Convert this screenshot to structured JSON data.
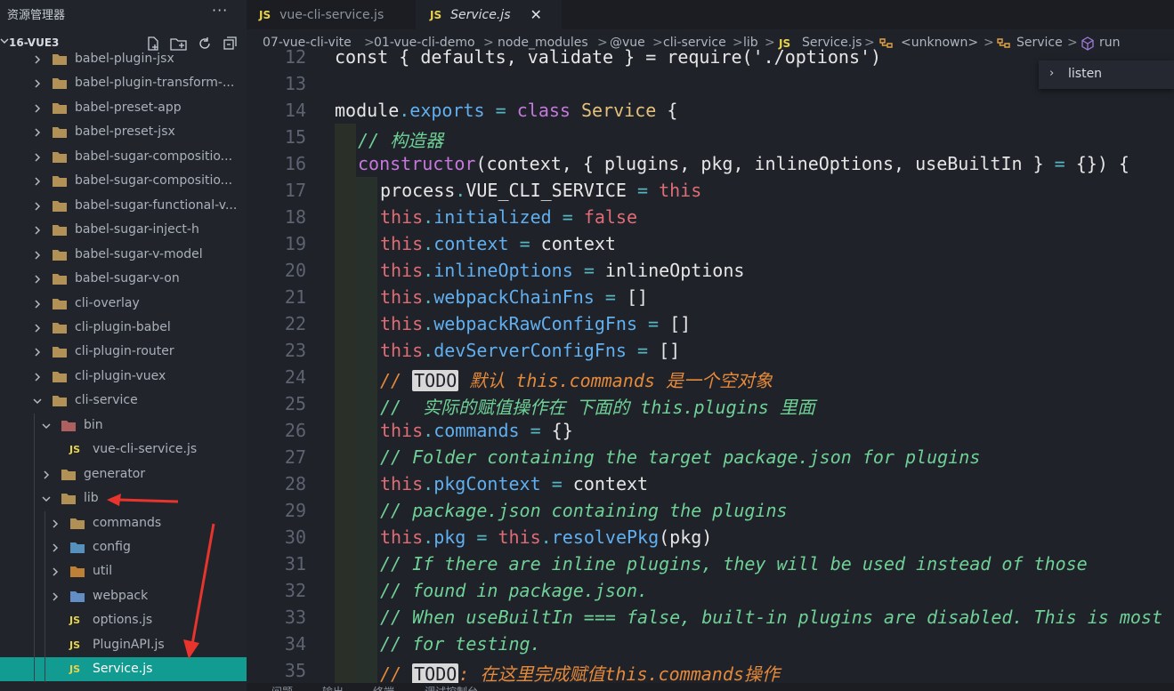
{
  "sidebar": {
    "title": "资源管理器",
    "more": "···",
    "project": "16-VUE3",
    "actions": [
      "new-file-icon",
      "new-folder-icon",
      "refresh-icon",
      "collapse-all-icon"
    ],
    "tree": [
      {
        "label": "babel-plugin-jsx",
        "type": "folder",
        "depth": 0,
        "expanded": false
      },
      {
        "label": "babel-plugin-transform-...",
        "type": "folder",
        "depth": 0,
        "expanded": false
      },
      {
        "label": "babel-preset-app",
        "type": "folder",
        "depth": 0,
        "expanded": false
      },
      {
        "label": "babel-preset-jsx",
        "type": "folder",
        "depth": 0,
        "expanded": false
      },
      {
        "label": "babel-sugar-compositio...",
        "type": "folder",
        "depth": 0,
        "expanded": false
      },
      {
        "label": "babel-sugar-compositio...",
        "type": "folder",
        "depth": 0,
        "expanded": false
      },
      {
        "label": "babel-sugar-functional-v...",
        "type": "folder",
        "depth": 0,
        "expanded": false
      },
      {
        "label": "babel-sugar-inject-h",
        "type": "folder",
        "depth": 0,
        "expanded": false
      },
      {
        "label": "babel-sugar-v-model",
        "type": "folder",
        "depth": 0,
        "expanded": false
      },
      {
        "label": "babel-sugar-v-on",
        "type": "folder",
        "depth": 0,
        "expanded": false
      },
      {
        "label": "cli-overlay",
        "type": "folder",
        "depth": 0,
        "expanded": false
      },
      {
        "label": "cli-plugin-babel",
        "type": "folder",
        "depth": 0,
        "expanded": false
      },
      {
        "label": "cli-plugin-router",
        "type": "folder",
        "depth": 0,
        "expanded": false
      },
      {
        "label": "cli-plugin-vuex",
        "type": "folder",
        "depth": 0,
        "expanded": false
      },
      {
        "label": "cli-service",
        "type": "folder-open",
        "depth": 0,
        "expanded": true
      },
      {
        "label": "bin",
        "type": "folder-bin",
        "depth": 1,
        "expanded": true
      },
      {
        "label": "vue-cli-service.js",
        "type": "js",
        "depth": 2
      },
      {
        "label": "generator",
        "type": "folder",
        "depth": 1,
        "expanded": false
      },
      {
        "label": "lib",
        "type": "folder-lib",
        "depth": 1,
        "expanded": true
      },
      {
        "label": "commands",
        "type": "folder-commands",
        "depth": 2,
        "expanded": false
      },
      {
        "label": "config",
        "type": "folder-config",
        "depth": 2,
        "expanded": false
      },
      {
        "label": "util",
        "type": "folder-util",
        "depth": 2,
        "expanded": false
      },
      {
        "label": "webpack",
        "type": "folder-webpack",
        "depth": 2,
        "expanded": false
      },
      {
        "label": "options.js",
        "type": "js",
        "depth": 2
      },
      {
        "label": "PluginAPI.js",
        "type": "js",
        "depth": 2
      },
      {
        "label": "Service.js",
        "type": "js",
        "depth": 2,
        "selected": true
      }
    ]
  },
  "tabs": [
    {
      "icon": "JS",
      "label": "vue-cli-service.js",
      "active": false
    },
    {
      "icon": "JS",
      "label": "Service.js",
      "active": true,
      "close": "✕"
    }
  ],
  "breadcrumb": {
    "parts": [
      "07-vue-cli-vite",
      "01-vue-cli-demo",
      "node_modules",
      "@vue",
      "cli-service",
      "lib"
    ],
    "file_icon": "JS",
    "file": "Service.js",
    "symbols": [
      "<unknown>",
      "Service",
      "run"
    ],
    "separator": ">"
  },
  "suggestion": {
    "label": "listen"
  },
  "code_lines": [
    {
      "n": "12",
      "segs": [
        [
          "plain",
          "const { defaults, validate } = require('./options')"
        ]
      ]
    },
    {
      "n": "13",
      "segs": []
    },
    {
      "n": "14",
      "segs": [
        [
          "plain",
          "module"
        ],
        [
          "op",
          "."
        ],
        [
          "prop",
          "exports"
        ],
        [
          "plain",
          " "
        ],
        [
          "op",
          "="
        ],
        [
          "plain",
          " "
        ],
        [
          "kw",
          "class"
        ],
        [
          "plain",
          " "
        ],
        [
          "cls",
          "Service"
        ],
        [
          "plain",
          " {"
        ]
      ]
    },
    {
      "n": "15",
      "segs": [
        [
          "com",
          "// 构造器"
        ]
      ]
    },
    {
      "n": "16",
      "segs": [
        [
          "fn",
          "constructor"
        ],
        [
          "plain",
          "(context, { plugins, pkg, inlineOptions, useBuiltIn } "
        ],
        [
          "op",
          "="
        ],
        [
          "plain",
          " {}) {"
        ]
      ]
    },
    {
      "n": "17",
      "segs": [
        [
          "plain",
          "process"
        ],
        [
          "op",
          "."
        ],
        [
          "plain",
          "VUE_CLI_SERVICE "
        ],
        [
          "op",
          "="
        ],
        [
          "plain",
          " "
        ],
        [
          "this",
          "this"
        ]
      ]
    },
    {
      "n": "18",
      "segs": [
        [
          "this",
          "this"
        ],
        [
          "op",
          "."
        ],
        [
          "prop",
          "initialized"
        ],
        [
          "plain",
          " "
        ],
        [
          "op",
          "="
        ],
        [
          "plain",
          " "
        ],
        [
          "this",
          "false"
        ]
      ]
    },
    {
      "n": "19",
      "segs": [
        [
          "this",
          "this"
        ],
        [
          "op",
          "."
        ],
        [
          "prop",
          "context"
        ],
        [
          "plain",
          " "
        ],
        [
          "op",
          "="
        ],
        [
          "plain",
          " context"
        ]
      ]
    },
    {
      "n": "20",
      "segs": [
        [
          "this",
          "this"
        ],
        [
          "op",
          "."
        ],
        [
          "prop",
          "inlineOptions"
        ],
        [
          "plain",
          " "
        ],
        [
          "op",
          "="
        ],
        [
          "plain",
          " inlineOptions"
        ]
      ]
    },
    {
      "n": "21",
      "segs": [
        [
          "this",
          "this"
        ],
        [
          "op",
          "."
        ],
        [
          "prop",
          "webpackChainFns"
        ],
        [
          "plain",
          " "
        ],
        [
          "op",
          "="
        ],
        [
          "plain",
          " []"
        ]
      ]
    },
    {
      "n": "22",
      "segs": [
        [
          "this",
          "this"
        ],
        [
          "op",
          "."
        ],
        [
          "prop",
          "webpackRawConfigFns"
        ],
        [
          "plain",
          " "
        ],
        [
          "op",
          "="
        ],
        [
          "plain",
          " []"
        ]
      ]
    },
    {
      "n": "23",
      "segs": [
        [
          "this",
          "this"
        ],
        [
          "op",
          "."
        ],
        [
          "prop",
          "devServerConfigFns"
        ],
        [
          "plain",
          " "
        ],
        [
          "op",
          "="
        ],
        [
          "plain",
          " []"
        ]
      ]
    },
    {
      "n": "24",
      "segs": [
        [
          "todo",
          "// "
        ],
        [
          "todobox",
          "TODO"
        ],
        [
          "todo",
          " 默认 this.commands 是一个空对象"
        ]
      ]
    },
    {
      "n": "25",
      "segs": [
        [
          "com",
          "//  实际的赋值操作在 下面的 this.plugins 里面"
        ]
      ]
    },
    {
      "n": "26",
      "segs": [
        [
          "this",
          "this"
        ],
        [
          "op",
          "."
        ],
        [
          "prop",
          "commands"
        ],
        [
          "plain",
          " "
        ],
        [
          "op",
          "="
        ],
        [
          "plain",
          " {}"
        ]
      ]
    },
    {
      "n": "27",
      "segs": [
        [
          "com",
          "// Folder containing the target package.json for plugins"
        ]
      ]
    },
    {
      "n": "28",
      "segs": [
        [
          "this",
          "this"
        ],
        [
          "op",
          "."
        ],
        [
          "prop",
          "pkgContext"
        ],
        [
          "plain",
          " "
        ],
        [
          "op",
          "="
        ],
        [
          "plain",
          " context"
        ]
      ]
    },
    {
      "n": "29",
      "segs": [
        [
          "com",
          "// package.json containing the plugins"
        ]
      ]
    },
    {
      "n": "30",
      "segs": [
        [
          "this",
          "this"
        ],
        [
          "op",
          "."
        ],
        [
          "prop",
          "pkg"
        ],
        [
          "plain",
          " "
        ],
        [
          "op",
          "="
        ],
        [
          "plain",
          " "
        ],
        [
          "this",
          "this"
        ],
        [
          "op",
          "."
        ],
        [
          "prop",
          "resolvePkg"
        ],
        [
          "plain",
          "(pkg)"
        ]
      ]
    },
    {
      "n": "31",
      "segs": [
        [
          "com",
          "// If there are inline plugins, they will be used instead of those"
        ]
      ]
    },
    {
      "n": "32",
      "segs": [
        [
          "com",
          "// found in package.json."
        ]
      ]
    },
    {
      "n": "33",
      "segs": [
        [
          "com",
          "// When useBuiltIn === false, built-in plugins are disabled. This is most"
        ]
      ]
    },
    {
      "n": "34",
      "segs": [
        [
          "com",
          "// for testing."
        ]
      ]
    },
    {
      "n": "35",
      "segs": [
        [
          "todo",
          "// "
        ],
        [
          "todobox",
          "TODO"
        ],
        [
          "todo",
          ": 在这里完成赋值this.commands操作"
        ]
      ]
    }
  ],
  "panel_tabs": [
    "问题",
    "输出",
    "终端",
    "调试控制台"
  ],
  "colors": {
    "accent_selection": "#119b91",
    "annotation_arrow": "#e8342c"
  }
}
